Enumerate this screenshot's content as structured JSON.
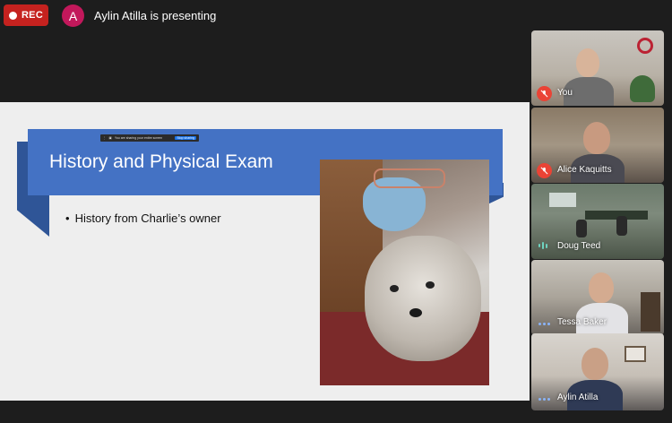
{
  "top_bar": {
    "rec_label": "REC",
    "avatar_letter": "A",
    "presenting_text": "Aylin Atilla is presenting"
  },
  "slide": {
    "title": "History and Physical Exam",
    "bullets": [
      "History from Charlie’s owner"
    ],
    "share_bar": {
      "message": "You are sharing your entire screen",
      "stop_label": "Stop sharing"
    }
  },
  "participants": [
    {
      "name": "You",
      "status": "muted"
    },
    {
      "name": "Alice Kaquitts",
      "status": "muted"
    },
    {
      "name": "Doug Teed",
      "status": "speaking"
    },
    {
      "name": "Tessa Baker",
      "status": "idle"
    },
    {
      "name": "Aylin Atilla",
      "status": "idle"
    }
  ],
  "colors": {
    "rec": "#c5221f",
    "avatar": "#c2185b",
    "banner": "#4472c4",
    "banner_dark": "#2f5597",
    "mic_off": "#ea4335",
    "background": "#1d1d1d"
  }
}
